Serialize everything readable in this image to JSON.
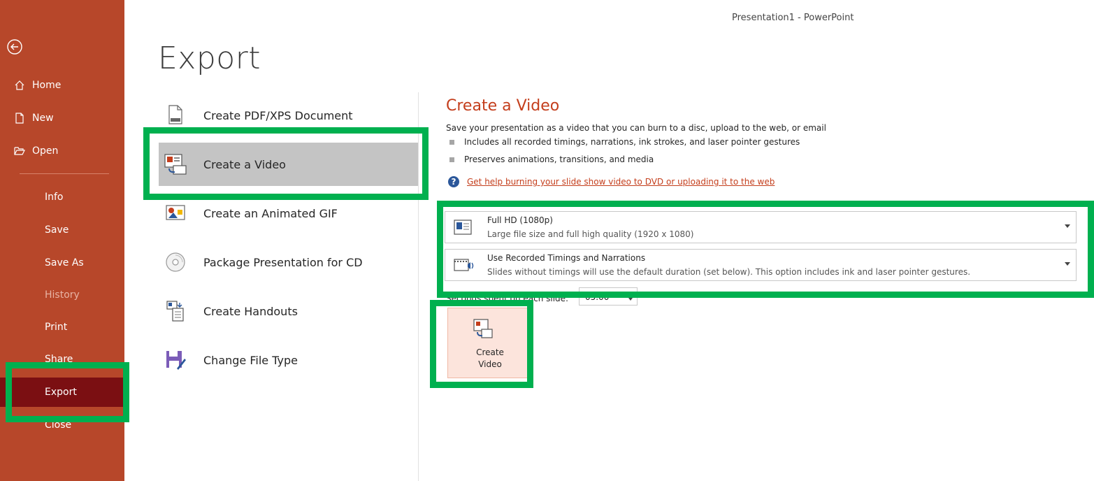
{
  "window": {
    "title": "Presentation1  -  PowerPoint"
  },
  "sidebar": {
    "back_icon": "back-arrow-icon",
    "items": [
      {
        "label": "Home",
        "icon": "home-icon"
      },
      {
        "label": "New",
        "icon": "new-doc-icon"
      },
      {
        "label": "Open",
        "icon": "folder-open-icon"
      },
      {
        "label": "Info"
      },
      {
        "label": "Save"
      },
      {
        "label": "Save As"
      },
      {
        "label": "History"
      },
      {
        "label": "Print"
      },
      {
        "label": "Share"
      },
      {
        "label": "Export"
      },
      {
        "label": "Close"
      }
    ]
  },
  "page": {
    "heading": "Export"
  },
  "export_options": [
    {
      "label": "Create PDF/XPS Document",
      "icon": "pdf-document-icon"
    },
    {
      "label": "Create a Video",
      "icon": "video-slide-icon"
    },
    {
      "label": "Create an Animated GIF",
      "icon": "animated-gif-icon"
    },
    {
      "label": "Package Presentation for CD",
      "icon": "cd-icon"
    },
    {
      "label": "Create Handouts",
      "icon": "handouts-icon"
    },
    {
      "label": "Change File Type",
      "icon": "save-disk-icon"
    }
  ],
  "video_pane": {
    "title": "Create a Video",
    "description": "Save your presentation as a video that you can burn to a disc, upload to the web, or email",
    "bullets": [
      "Includes all recorded timings, narrations, ink strokes, and laser pointer gestures",
      "Preserves animations, transitions, and media"
    ],
    "help_link": "Get help burning your slide show video to DVD or uploading it to the web",
    "quality": {
      "title": "Full HD (1080p)",
      "subtitle": "Large file size and full high quality (1920 x 1080)"
    },
    "timings": {
      "title": "Use Recorded Timings and Narrations",
      "subtitle": "Slides without timings will use the default duration (set below). This option includes ink and laser pointer gestures."
    },
    "seconds_label": "Seconds spent on each slide:",
    "seconds_value": "05.00",
    "create_button": "Create\nVideo"
  },
  "colors": {
    "sidebar": "#b7472a",
    "sidebar_selected": "#7b0f12",
    "accent": "#c43e1c",
    "highlight": "#00b04f"
  }
}
